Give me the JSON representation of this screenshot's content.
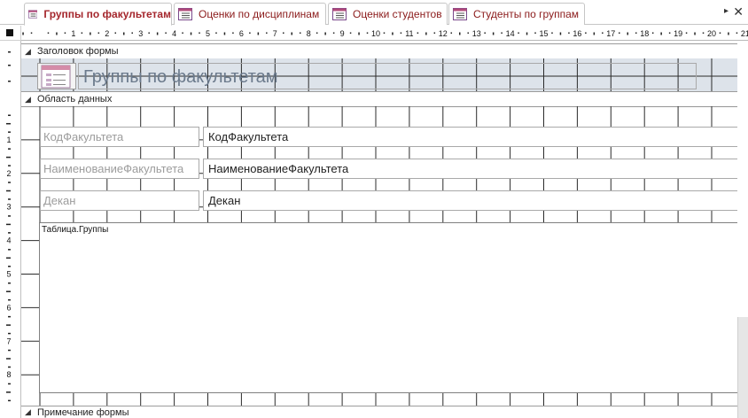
{
  "tabs": [
    {
      "label": "Группы по факультетам",
      "active": true
    },
    {
      "label": "Оценки по дисциплинам",
      "active": false
    },
    {
      "label": "Оценки студентов",
      "active": false
    },
    {
      "label": "Студенты по группам",
      "active": false
    }
  ],
  "tabbar": {
    "scroll_right_icon": "▸",
    "close_icon": "✕"
  },
  "ruler": {
    "h_labels": [
      "1",
      "2",
      "3",
      "4",
      "5",
      "6",
      "7",
      "8",
      "9",
      "10",
      "11",
      "12",
      "13",
      "14",
      "15",
      "16",
      "17",
      "18",
      "19",
      "20",
      "21"
    ],
    "v_labels": [
      "1",
      "2",
      "3",
      "4",
      "5",
      "6",
      "7",
      "8"
    ]
  },
  "sections": {
    "header": "Заголовок формы",
    "detail": "Область данных",
    "footer": "Примечание формы"
  },
  "form": {
    "title": "Группы по факультетам"
  },
  "fields": [
    {
      "label": "КодФакультета",
      "value": "КодФакультета"
    },
    {
      "label": "НаименованиеФакультета",
      "value": "НаименованиеФакультета"
    },
    {
      "label": "Декан",
      "value": "Декан"
    }
  ],
  "subform": {
    "label": "Таблица.Группы"
  },
  "colors": {
    "tab_text": "#a4262c",
    "header_band": "#dde3ea",
    "grid_line": "#2b2b2b",
    "label_text": "#9c9c9c"
  }
}
